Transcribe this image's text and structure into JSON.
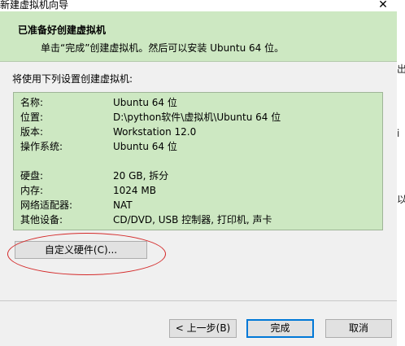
{
  "window": {
    "title": "新建虚拟机向导",
    "close_symbol": "✕"
  },
  "header": {
    "title": "已准备好创建虚拟机",
    "subtitle": "单击“完成”创建虚拟机。然后可以安装 Ubuntu 64 位。"
  },
  "intro_text": "将使用下列设置创建虚拟机:",
  "summary": {
    "group1": [
      {
        "label": "名称:",
        "value": "Ubuntu 64 位"
      },
      {
        "label": "位置:",
        "value": "D:\\python软件\\虚拟机\\Ubuntu 64 位"
      },
      {
        "label": "版本:",
        "value": "Workstation 12.0"
      },
      {
        "label": "操作系统:",
        "value": "Ubuntu 64 位"
      }
    ],
    "group2": [
      {
        "label": "硬盘:",
        "value": "20 GB, 拆分"
      },
      {
        "label": "内存:",
        "value": "1024 MB"
      },
      {
        "label": "网络适配器:",
        "value": "NAT"
      },
      {
        "label": "其他设备:",
        "value": "CD/DVD, USB 控制器, 打印机, 声卡"
      }
    ]
  },
  "buttons": {
    "customize": "自定义硬件(C)...",
    "back": "< 上一步(B)",
    "finish": "完成",
    "cancel": "取消"
  },
  "background_fragments": [
    "出",
    "i",
    "以"
  ],
  "colors": {
    "header_bg": "#cde8c2",
    "summary_bg": "#cde8c2",
    "annotation_ellipse": "#d42a2a",
    "default_button_border": "#0078d7"
  }
}
